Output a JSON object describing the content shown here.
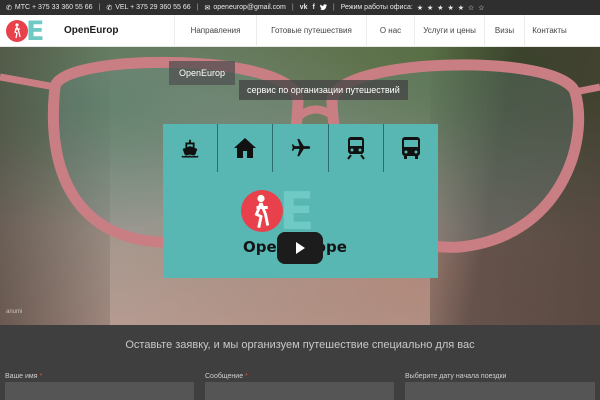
{
  "topbar": {
    "phone_mts": "МТС + 375 33 360 55 66",
    "phone_vel": "VEL + 375 29 360 55 66",
    "email": "openeurop@gmail.com",
    "hours_label": "Режим работы офиса:",
    "stars": "★ ★ ★ ★ ★ ☆ ☆",
    "social": [
      "vk-icon",
      "facebook-icon",
      "twitter-icon"
    ]
  },
  "header": {
    "logo_text": "OpenEurop",
    "nav": [
      "Направления",
      "Готовые путешествия",
      "О нас",
      "Услуги и цены",
      "Визы",
      "Контакты"
    ]
  },
  "hero": {
    "pill_brand": "OpenEurop",
    "pill_tagline": "сервис по организации путешествий",
    "watermark": "anumi"
  },
  "video": {
    "transport_icons": [
      "ship-icon",
      "house-icon",
      "plane-icon",
      "train-icon",
      "bus-icon"
    ],
    "logo_text": "OpenEurope"
  },
  "form": {
    "title": "Оставьте заявку, и мы организуем путешествие специально для вас",
    "name_label": "Ваше имя",
    "message_label": "Сообщение",
    "date_label": "Выберите дату начала поездки",
    "required_mark": "*"
  },
  "colors": {
    "brand_red": "#e8414b",
    "brand_teal": "#6fc9c4",
    "video_bg": "#58b7b3",
    "topbar_bg": "#2f2f2f",
    "form_bg": "#3f3f3f"
  }
}
